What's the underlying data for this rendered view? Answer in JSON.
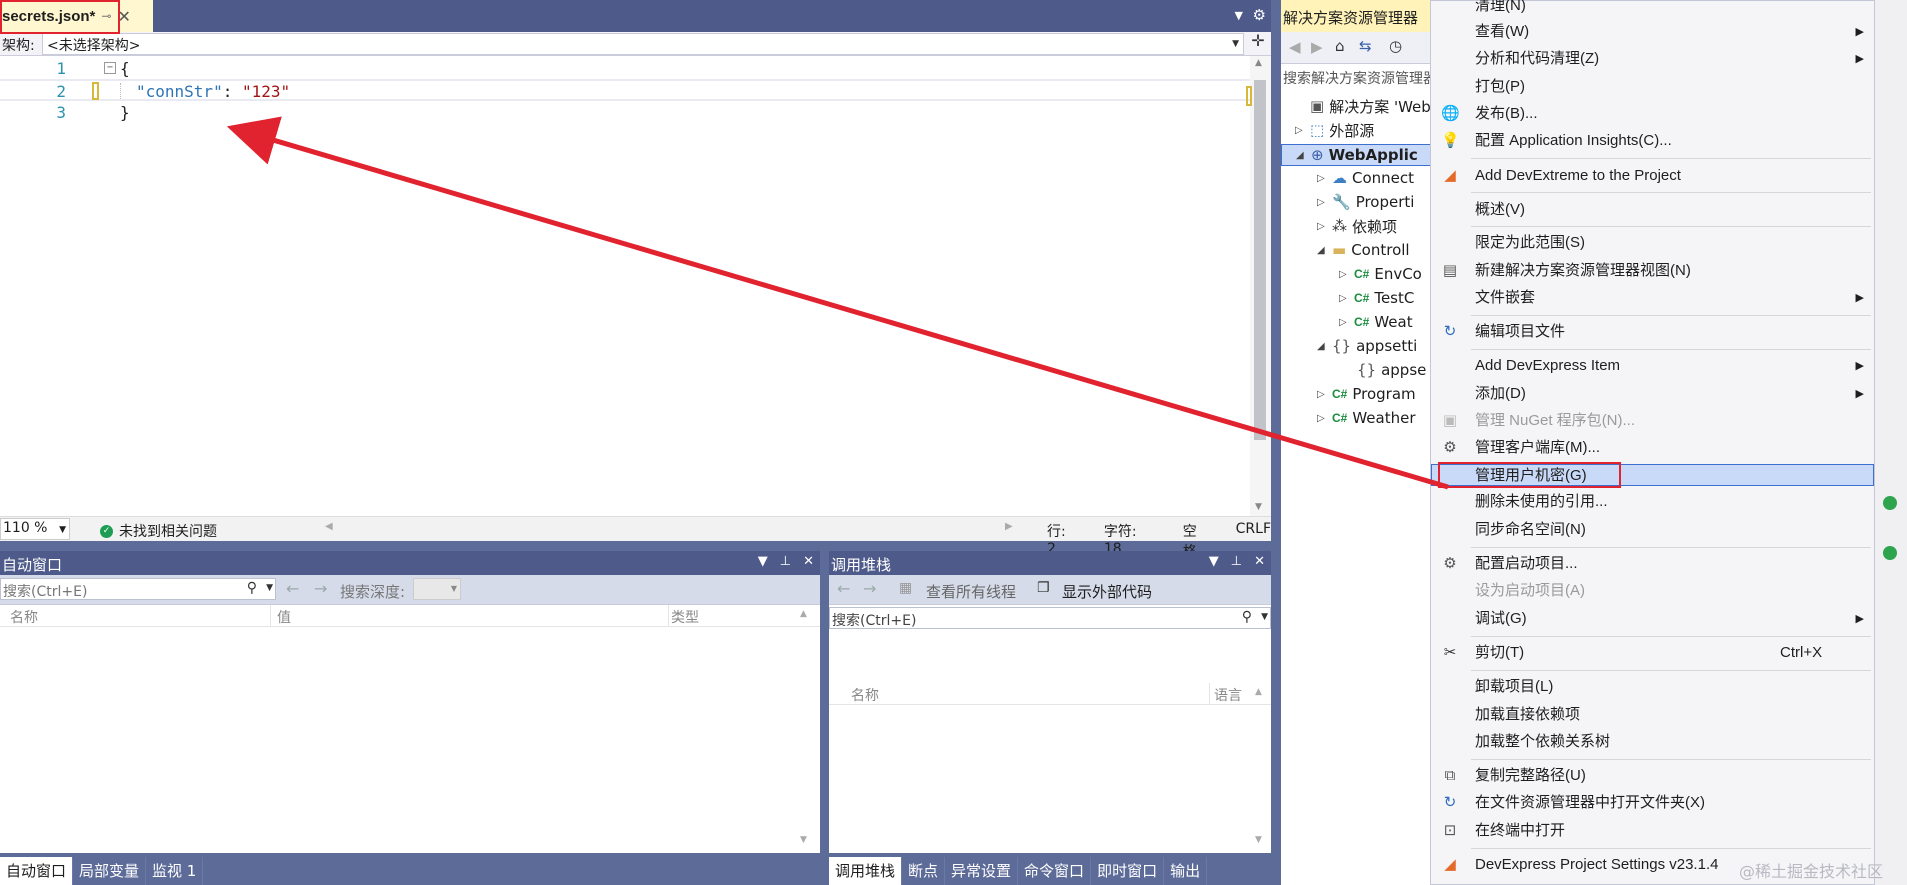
{
  "editor": {
    "tab_name": "secrets.json*",
    "tab_pin": "⊸",
    "tab_close": "✕",
    "nav_label": "架构:",
    "nav_combo": "<未选择架构>",
    "lines": [
      {
        "num": "1",
        "text": "{"
      },
      {
        "num": "2",
        "key": "\"connStr\"",
        "sep": ": ",
        "value": "\"123\""
      },
      {
        "num": "3",
        "text": "}"
      }
    ],
    "zoom": "110 %",
    "issues": "未找到相关问题",
    "row": "行: 2",
    "col": "字符: 18",
    "ws": "空格",
    "eol": "CRLF"
  },
  "auto_window": {
    "title": "自动窗口",
    "search_placeholder": "搜索(Ctrl+E)",
    "depth_label": "搜索深度:",
    "columns": [
      "名称",
      "值",
      "类型"
    ],
    "tabs": [
      "自动窗口",
      "局部变量",
      "监视 1"
    ]
  },
  "call_stack": {
    "title": "调用堆栈",
    "view_all_threads": "查看所有线程",
    "show_external": "显示外部代码",
    "search_placeholder": "搜索(Ctrl+E)",
    "columns": [
      "名称",
      "语言"
    ],
    "tabs": [
      "调用堆栈",
      "断点",
      "异常设置",
      "命令窗口",
      "即时窗口",
      "输出"
    ]
  },
  "solution_explorer": {
    "title": "解决方案资源管理器",
    "search_placeholder": "搜索解决方案资源管理器",
    "items": [
      {
        "label": "解决方案 'WebA"
      },
      {
        "label": "外部源"
      },
      {
        "label": "WebApplic"
      },
      {
        "label": "Connect"
      },
      {
        "label": "Properti"
      },
      {
        "label": "依赖项"
      },
      {
        "label": "Controll"
      },
      {
        "label": "EnvCo"
      },
      {
        "label": "TestC"
      },
      {
        "label": "Weat"
      },
      {
        "label": "appsetti"
      },
      {
        "label": "appse"
      },
      {
        "label": "Program"
      },
      {
        "label": "Weather"
      }
    ],
    "cs_badge": "C#"
  },
  "context_menu": {
    "items": [
      {
        "label": "清理(N)"
      },
      {
        "label": "查看(W)"
      },
      {
        "label": "分析和代码清理(Z)"
      },
      {
        "label": "打包(P)"
      },
      {
        "label": "发布(B)..."
      },
      {
        "label": "配置 Application Insights(C)..."
      },
      {
        "label": "Add DevExtreme to the Project"
      },
      {
        "label": "概述(V)"
      },
      {
        "label": "限定为此范围(S)"
      },
      {
        "label": "新建解决方案资源管理器视图(N)"
      },
      {
        "label": "文件嵌套"
      },
      {
        "label": "编辑项目文件"
      },
      {
        "label": "Add DevExpress Item"
      },
      {
        "label": "添加(D)"
      },
      {
        "label": "管理 NuGet 程序包(N)..."
      },
      {
        "label": "管理客户端库(M)..."
      },
      {
        "label": "管理用户机密(G)"
      },
      {
        "label": "删除未使用的引用..."
      },
      {
        "label": "同步命名空间(N)"
      },
      {
        "label": "配置启动项目..."
      },
      {
        "label": "设为启动项目(A)"
      },
      {
        "label": "调试(G)"
      },
      {
        "label": "剪切(T)",
        "shortcut": "Ctrl+X"
      },
      {
        "label": "卸载项目(L)"
      },
      {
        "label": "加载直接依赖项"
      },
      {
        "label": "加载整个依赖关系树"
      },
      {
        "label": "复制完整路径(U)"
      },
      {
        "label": "在文件资源管理器中打开文件夹(X)"
      },
      {
        "label": "在终端中打开"
      },
      {
        "label": "DevExpress Project Settings v23.1.4"
      }
    ]
  },
  "watermark": "@稀土掘金技术社区",
  "colors": {
    "accent": "#4d5a8a",
    "highlight": "#c9daf8",
    "annotation": "#e1222f"
  }
}
